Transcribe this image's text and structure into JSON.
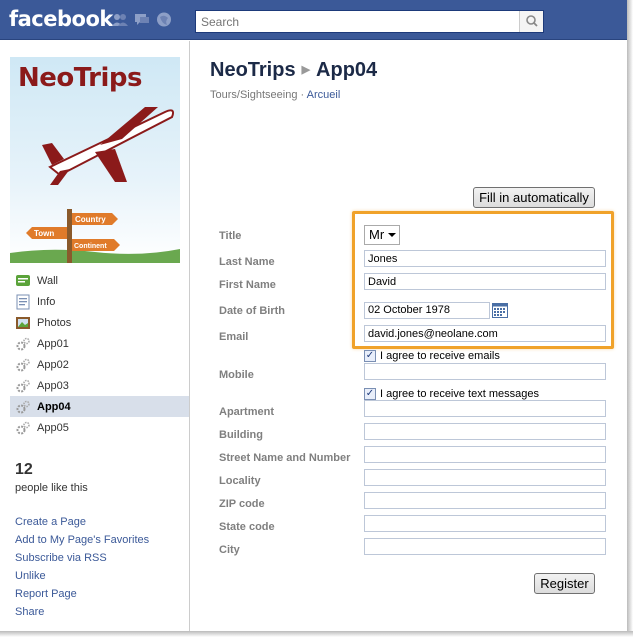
{
  "topbar": {
    "logo": "facebook",
    "icons": [
      "friends-icon",
      "messages-icon",
      "notifications-icon"
    ],
    "search_placeholder": "Search",
    "brand_color": "#3b5998"
  },
  "profile": {
    "logo_text": "NeoTrips",
    "sign_country": "Country",
    "sign_town": "Town",
    "sign_continent": "Continent"
  },
  "nav": {
    "items": [
      {
        "label": "Wall",
        "icon": "wall-icon"
      },
      {
        "label": "Info",
        "icon": "info-icon"
      },
      {
        "label": "Photos",
        "icon": "photos-icon"
      },
      {
        "label": "App01",
        "icon": "app-gear-icon"
      },
      {
        "label": "App02",
        "icon": "app-gear-icon"
      },
      {
        "label": "App03",
        "icon": "app-gear-icon"
      },
      {
        "label": "App04",
        "icon": "app-gear-icon",
        "active": true
      },
      {
        "label": "App05",
        "icon": "app-gear-icon"
      }
    ]
  },
  "likes": {
    "count": "12",
    "text": "people like this"
  },
  "links": [
    "Create a Page",
    "Add to My Page's Favorites",
    "Subscribe via RSS",
    "Unlike",
    "Report Page",
    "Share"
  ],
  "header": {
    "page_name": "NeoTrips",
    "app_name": "App04",
    "category": "Tours/Sightseeing",
    "separator": "·",
    "home_link": "Arcueil"
  },
  "form": {
    "fill_button": "Fill in automatically",
    "labels": {
      "title": "Title",
      "last_name": "Last Name",
      "first_name": "First Name",
      "dob": "Date of Birth",
      "email": "Email",
      "mobile": "Mobile",
      "apartment": "Apartment",
      "building": "Building",
      "street": "Street Name and Number",
      "locality": "Locality",
      "zip": "ZIP code",
      "state": "State code",
      "city": "City"
    },
    "values": {
      "title": "Mr",
      "last_name": "Jones",
      "first_name": "David",
      "dob": "02 October 1978",
      "email": "david.jones@neolane.com",
      "mobile": "",
      "apartment": "",
      "building": "",
      "street": "",
      "locality": "",
      "zip": "",
      "state": "",
      "city": ""
    },
    "agree_emails": "I agree to receive emails",
    "agree_texts": "I agree to receive text messages",
    "agree_emails_checked": true,
    "agree_texts_checked": true,
    "register_button": "Register",
    "highlight_color": "#f0a22a"
  }
}
